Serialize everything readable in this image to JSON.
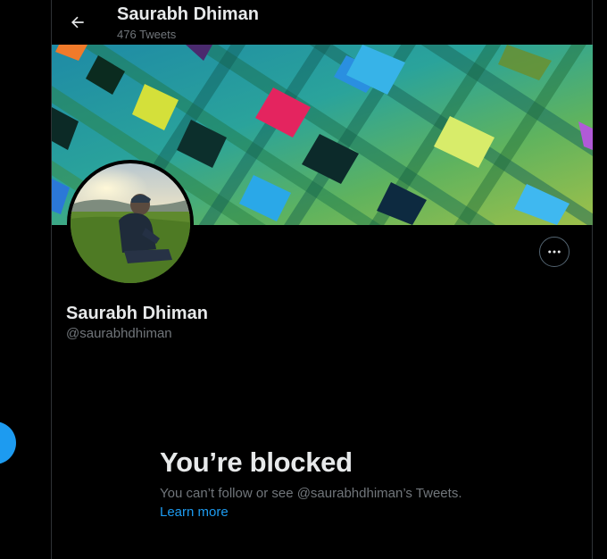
{
  "header": {
    "name": "Saurabh Dhiman",
    "tweet_count": "476 Tweets"
  },
  "profile": {
    "name": "Saurabh Dhiman",
    "handle": "@saurabhdhiman"
  },
  "blocked": {
    "title": "You’re blocked",
    "message": "You can’t follow or see @saurabhdhiman’s Tweets.",
    "link": "Learn more"
  },
  "colors": {
    "background": "#000000",
    "accent": "#1d9bf0",
    "primary_text": "#e7e9ea",
    "secondary_text": "#71767b",
    "border": "#2f3336"
  },
  "icons": {
    "back": "arrow-left-icon",
    "more": "more-horizontal-icon"
  }
}
